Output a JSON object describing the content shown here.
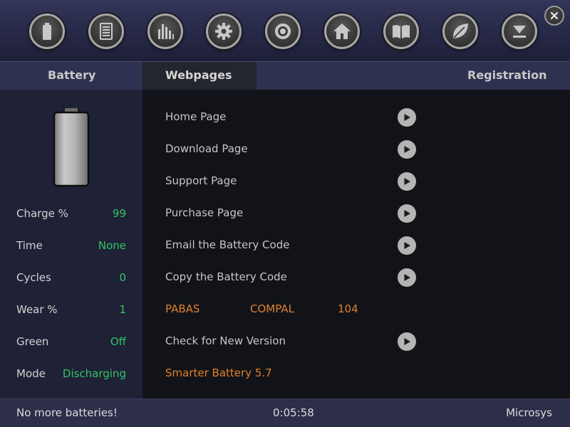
{
  "toolbar": {
    "buttons": [
      {
        "icon": "battery-icon"
      },
      {
        "icon": "list-icon"
      },
      {
        "icon": "bar-chart-icon"
      },
      {
        "icon": "gear-icon"
      },
      {
        "icon": "target-icon"
      },
      {
        "icon": "home-icon"
      },
      {
        "icon": "book-icon"
      },
      {
        "icon": "leaf-icon"
      },
      {
        "icon": "minimize-icon"
      }
    ],
    "close_icon": "close-icon"
  },
  "tabs": {
    "battery": "Battery",
    "webpages": "Webpages",
    "registration": "Registration"
  },
  "stats": {
    "charge": {
      "label": "Charge %",
      "value": "99"
    },
    "time": {
      "label": "Time",
      "value": "None"
    },
    "cycles": {
      "label": "Cycles",
      "value": "0"
    },
    "wear": {
      "label": "Wear %",
      "value": "1"
    },
    "green": {
      "label": "Green",
      "value": "Off"
    },
    "mode": {
      "label": "Mode",
      "value": "Discharging"
    }
  },
  "links": {
    "home": "Home Page",
    "download": "Download Page",
    "support": "Support Page",
    "purchase": "Purchase Page",
    "email_code": "Email the Battery Code",
    "copy_code": "Copy the Battery Code",
    "check_version": "Check for New Version"
  },
  "battery_info": {
    "code1": "PABAS",
    "code2": "COMPAL",
    "code3": "104"
  },
  "version": "Smarter Battery 5.7",
  "status": {
    "message": "No more batteries!",
    "timer": "0:05:58",
    "brand": "Microsys"
  },
  "colors": {
    "accent_green": "#31c465",
    "accent_orange": "#e0802f",
    "panel_navy": "#1f2136",
    "main_bg": "#121318"
  }
}
